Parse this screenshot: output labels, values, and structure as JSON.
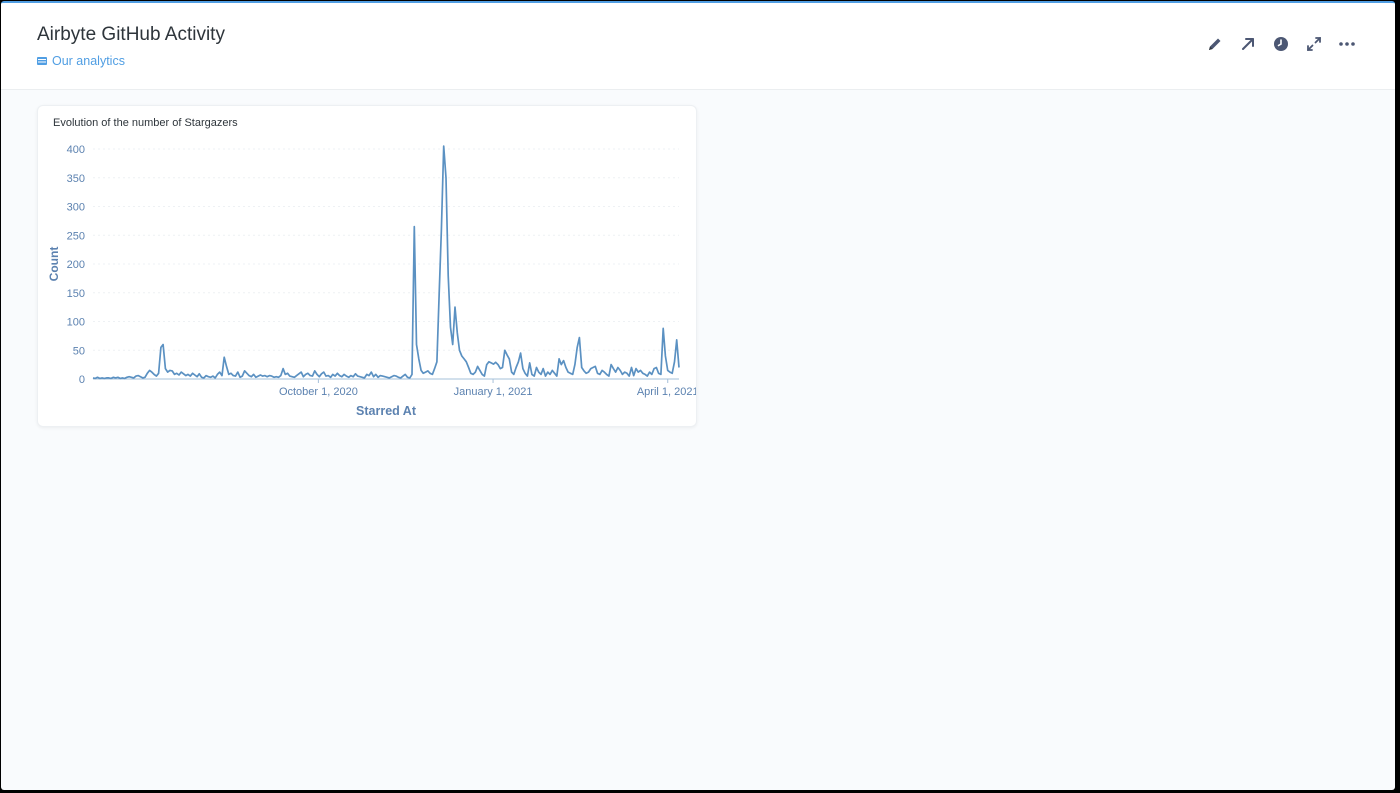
{
  "dashboard": {
    "title": "Airbyte GitHub Activity",
    "collection": "Our analytics"
  },
  "actions": [
    {
      "icon": "pencil-icon",
      "name": "edit-dashboard-button"
    },
    {
      "icon": "share-arrow-icon",
      "name": "share-button"
    },
    {
      "icon": "clock-icon",
      "name": "auto-refresh-button"
    },
    {
      "icon": "fullscreen-icon",
      "name": "fullscreen-button"
    },
    {
      "icon": "ellipsis-icon",
      "name": "more-button"
    }
  ],
  "colors": {
    "accent": "#509ee3",
    "line": "#5b91c2",
    "axis": "#5c82b0"
  },
  "card": {
    "title": "Evolution of the number of Stargazers"
  },
  "chart_data": {
    "type": "line",
    "xlabel": "Starred At",
    "ylabel": "Count",
    "ylim": [
      0,
      400
    ],
    "yticks": [
      0,
      50,
      100,
      150,
      200,
      250,
      300,
      350,
      400
    ],
    "xtick_labels": [
      "October 1, 2020",
      "January 1, 2021",
      "April 1, 2021"
    ],
    "series": [
      {
        "values": [
          2,
          1,
          3,
          1,
          2,
          1,
          2,
          2,
          1,
          3,
          2,
          3,
          1,
          2,
          1,
          3,
          4,
          3,
          2,
          5,
          6,
          4,
          2,
          3,
          10,
          15,
          12,
          8,
          5,
          10,
          55,
          60,
          18,
          12,
          15,
          14,
          8,
          10,
          7,
          12,
          9,
          6,
          8,
          5,
          10,
          7,
          4,
          9,
          3,
          2,
          6,
          4,
          3,
          5,
          2,
          8,
          12,
          6,
          38,
          22,
          8,
          10,
          6,
          5,
          12,
          3,
          5,
          14,
          10,
          6,
          4,
          8,
          3,
          5,
          7,
          5,
          6,
          4,
          6,
          5,
          3,
          4,
          3,
          6,
          18,
          8,
          10,
          5,
          4,
          3,
          6,
          9,
          12,
          4,
          8,
          10,
          6,
          5,
          14,
          8,
          4,
          9,
          12,
          5,
          6,
          3,
          8,
          5,
          10,
          6,
          4,
          8,
          5,
          3,
          6,
          4,
          9,
          5,
          4,
          3,
          2,
          8,
          6,
          12,
          4,
          8,
          3,
          6,
          5,
          4,
          3,
          2,
          4,
          6,
          5,
          3,
          2,
          5,
          8,
          3,
          2,
          8,
          265,
          60,
          35,
          15,
          10,
          12,
          14,
          10,
          8,
          18,
          30,
          150,
          260,
          405,
          350,
          180,
          90,
          60,
          125,
          80,
          50,
          40,
          35,
          30,
          20,
          10,
          8,
          12,
          22,
          15,
          8,
          5,
          25,
          30,
          28,
          26,
          29,
          25,
          18,
          20,
          50,
          42,
          35,
          12,
          8,
          20,
          30,
          45,
          18,
          10,
          5,
          28,
          8,
          5,
          20,
          12,
          8,
          18,
          5,
          12,
          8,
          15,
          10,
          5,
          35,
          25,
          32,
          20,
          12,
          10,
          8,
          25,
          55,
          72,
          20,
          14,
          10,
          12,
          18,
          20,
          22,
          10,
          8,
          15,
          12,
          8,
          5,
          25,
          18,
          12,
          20,
          15,
          8,
          12,
          10,
          5,
          20,
          6,
          18,
          12,
          15,
          10,
          8,
          5,
          12,
          8,
          18,
          20,
          10,
          8,
          88,
          40,
          15,
          12,
          10,
          30,
          68,
          20
        ]
      }
    ]
  }
}
